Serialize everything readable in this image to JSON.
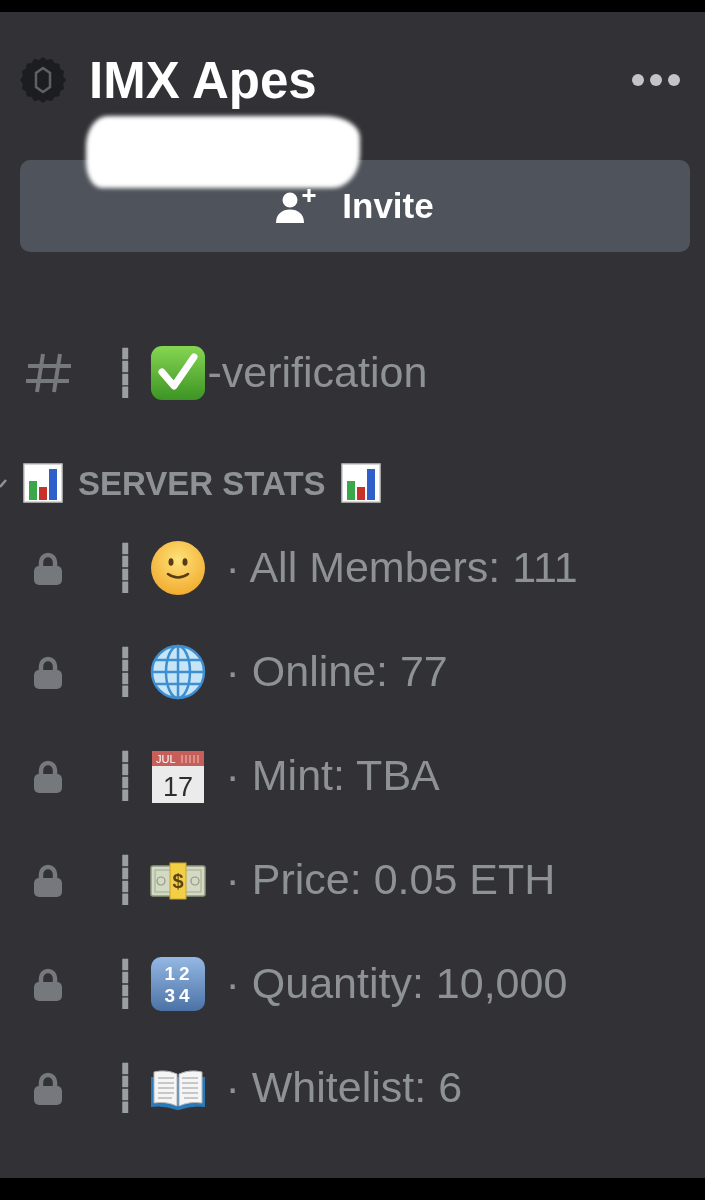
{
  "server": {
    "name": "IMX Apes"
  },
  "subtitle": {
    "redacted": true
  },
  "invite_button": {
    "label": "Invite"
  },
  "channels": [
    {
      "kind": "text",
      "prefix": "┊",
      "emoji": {
        "kind": "check"
      },
      "name": "-verification"
    }
  ],
  "category": {
    "name": "SERVER STATS",
    "expanded": true,
    "leading_emoji": {
      "kind": "chart"
    },
    "trailing_emoji": {
      "kind": "chart"
    },
    "channels": [
      {
        "kind": "locked",
        "prefix": "┊",
        "emoji": {
          "kind": "smile"
        },
        "name": "· All Members: 111"
      },
      {
        "kind": "locked",
        "prefix": "┊",
        "emoji": {
          "kind": "globe"
        },
        "name": "· Online: 77"
      },
      {
        "kind": "locked",
        "prefix": "┊",
        "emoji": {
          "kind": "calendar",
          "labels": [
            "JUL",
            "17"
          ]
        },
        "name": "· Mint: TBA"
      },
      {
        "kind": "locked",
        "prefix": "┊",
        "emoji": {
          "kind": "banknotes",
          "labels": [
            "$"
          ]
        },
        "name": "· Price: 0.05 ETH"
      },
      {
        "kind": "locked",
        "prefix": "┊",
        "emoji": {
          "kind": "keycap",
          "labels": [
            "12",
            "34"
          ]
        },
        "name": "· Quantity: 10,000"
      },
      {
        "kind": "locked",
        "prefix": "┊",
        "emoji": {
          "kind": "book"
        },
        "name": "· Whitelist: 6"
      }
    ]
  }
}
